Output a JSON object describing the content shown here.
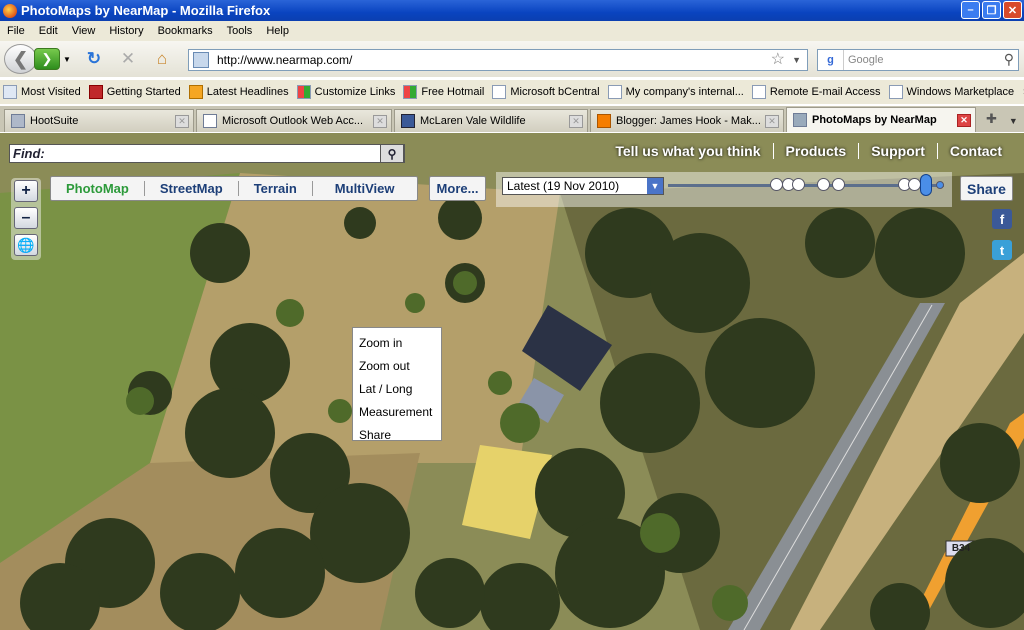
{
  "window": {
    "title": "PhotoMaps by NearMap - Mozilla Firefox"
  },
  "menu": [
    "File",
    "Edit",
    "View",
    "History",
    "Bookmarks",
    "Tools",
    "Help"
  ],
  "nav": {
    "url": "http://www.nearmap.com/",
    "search_placeholder": "Google"
  },
  "bookmarks": [
    "Most Visited",
    "Getting Started",
    "Latest Headlines",
    "Customize Links",
    "Free Hotmail",
    "Microsoft bCentral",
    "My company's internal...",
    "Remote E-mail Access",
    "Windows Marketplace"
  ],
  "bookmarks_more": "»",
  "tabs": [
    {
      "label": "HootSuite"
    },
    {
      "label": "Microsoft Outlook Web Acc..."
    },
    {
      "label": "McLaren Vale Wildlife"
    },
    {
      "label": "Blogger: James Hook - Mak..."
    },
    {
      "label": "PhotoMaps by NearMap"
    }
  ],
  "map": {
    "find_label": "Find:",
    "top_links": [
      "Tell us what you think",
      "Products",
      "Support",
      "Contact"
    ],
    "map_tabs": [
      "PhotoMap",
      "StreetMap",
      "Terrain",
      "MultiView"
    ],
    "more_label": "More...",
    "date_selected": "Latest (19 Nov 2010)",
    "share_label": "Share",
    "road_label": "B34",
    "context_menu": [
      "Zoom in",
      "Zoom out",
      "Lat / Long",
      "Measurement",
      "Share"
    ]
  },
  "colors": {
    "map_tab_active": "#2c9a3a",
    "map_tab_text": "#1d3f78",
    "road_orange": "#f0a030"
  }
}
